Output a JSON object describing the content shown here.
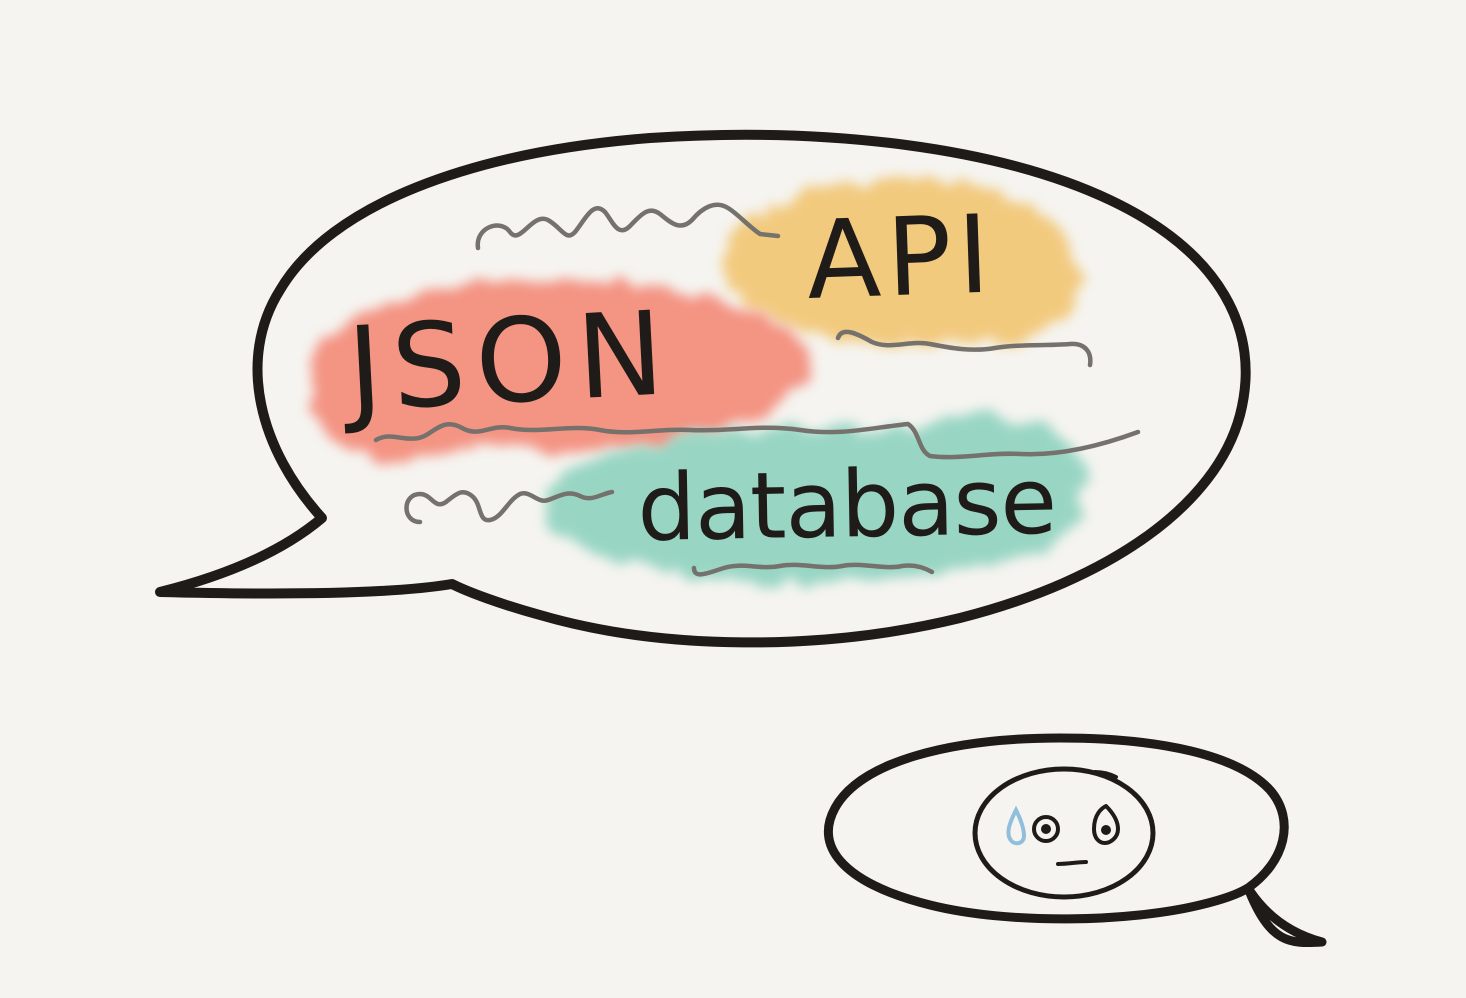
{
  "sketch": {
    "labels": {
      "json": "JSON",
      "api": "API",
      "database": "database"
    },
    "colors": {
      "background": "#f5f4f0",
      "ink": "#1e1b18",
      "json_highlight": "#f47f6c",
      "api_highlight": "#f2c166",
      "database_highlight": "#7fcdb7",
      "squiggle": "#75716c",
      "sweat_drop": "#8fbfdc"
    },
    "icons": {
      "face": "worried-face-icon",
      "sweat": "sweat-drop-icon"
    }
  }
}
